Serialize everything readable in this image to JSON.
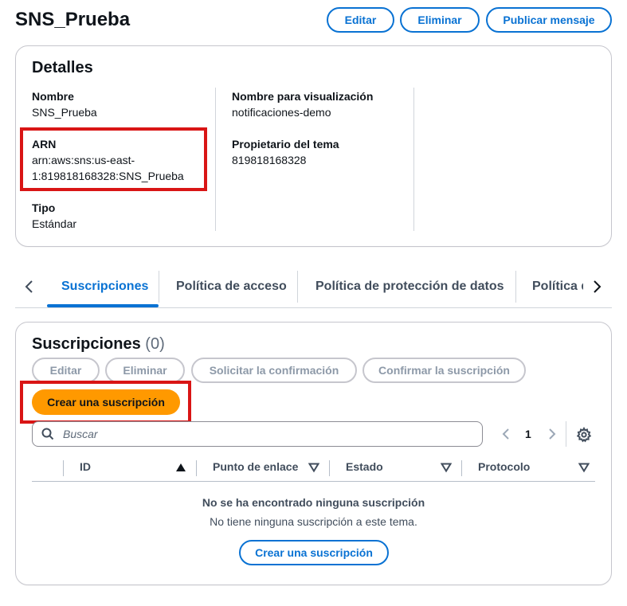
{
  "header": {
    "title": "SNS_Prueba",
    "edit_label": "Editar",
    "delete_label": "Eliminar",
    "publish_label": "Publicar mensaje"
  },
  "details": {
    "title": "Detalles",
    "name_label": "Nombre",
    "name_value": "SNS_Prueba",
    "arn_label": "ARN",
    "arn_line1": "arn:aws:sns:us-east-",
    "arn_line2": "1:819818168328:SNS_Prueba",
    "type_label": "Tipo",
    "type_value": "Estándar",
    "display_name_label": "Nombre para visualización",
    "display_name_value": "notificaciones-demo",
    "owner_label": "Propietario del tema",
    "owner_value": "819818168328"
  },
  "tabs": [
    {
      "label": "Suscripciones",
      "active": true
    },
    {
      "label": "Política de acceso",
      "active": false
    },
    {
      "label": "Política de protección de datos",
      "active": false
    },
    {
      "label": "Política d",
      "active": false
    }
  ],
  "subscriptions": {
    "title": "Suscripciones",
    "count": "(0)",
    "edit_label": "Editar",
    "delete_label": "Eliminar",
    "request_confirm_label": "Solicitar la confirmación",
    "confirm_label": "Confirmar la suscripción",
    "create_label": "Crear una suscripción",
    "search_placeholder": "Buscar",
    "page_number": "1",
    "columns": [
      "ID",
      "Punto de enlace",
      "Estado",
      "Protocolo"
    ],
    "empty_title": "No se ha encontrado ninguna suscripción",
    "empty_desc": "No tiene ninguna suscripción a este tema.",
    "empty_create_label": "Crear una suscripción"
  },
  "colors": {
    "accent": "#0972d3",
    "primary_button": "#ff9900",
    "highlight": "#d91515"
  }
}
